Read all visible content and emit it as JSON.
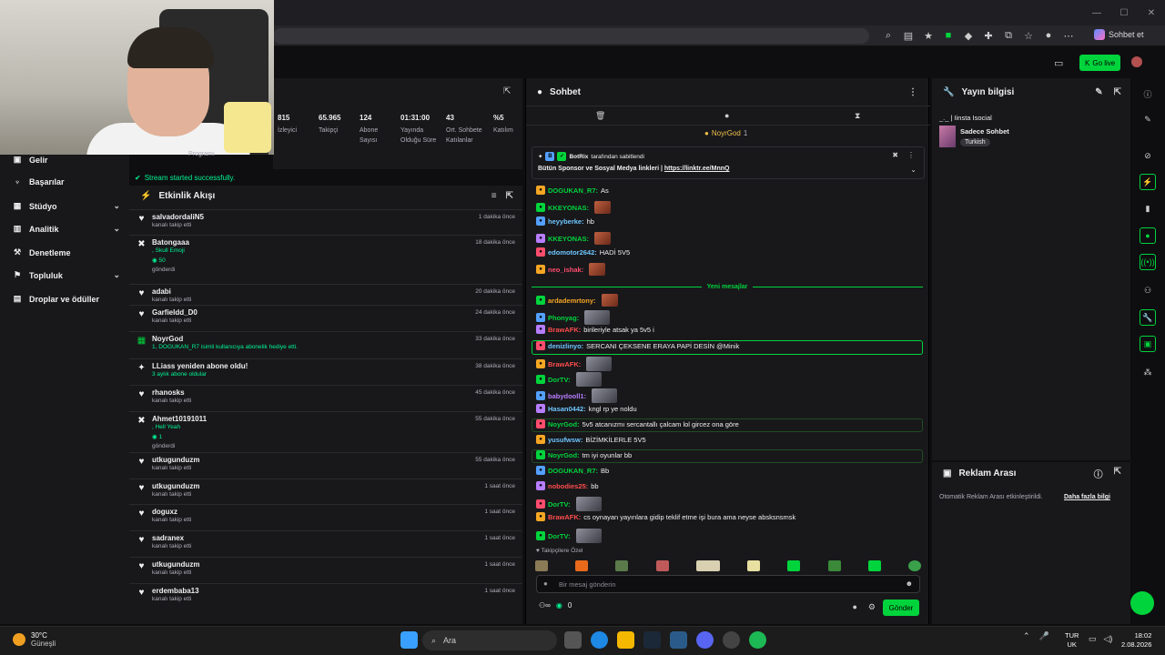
{
  "browser": {
    "profile_label": "Sohbet et"
  },
  "header": {
    "go_live_label": "Go live"
  },
  "sidebar": {
    "items": [
      {
        "label": "Gelir",
        "icon": "revenue-icon"
      },
      {
        "label": "Başarılar",
        "icon": "trophy-icon"
      },
      {
        "label": "Stüdyo",
        "icon": "studio-icon",
        "expand": true
      },
      {
        "label": "Analitik",
        "icon": "analytics-icon",
        "expand": true
      },
      {
        "label": "Denetleme",
        "icon": "moderation-icon"
      },
      {
        "label": "Topluluk",
        "icon": "community-icon",
        "expand": true
      },
      {
        "label": "Droplar ve ödüller",
        "icon": "drops-icon"
      }
    ]
  },
  "stats": [
    {
      "value": "815",
      "label": "İzleyici"
    },
    {
      "value": "65.965",
      "label": "Takipçi"
    },
    {
      "value": "124",
      "label": "Abone Sayısı"
    },
    {
      "value": "01:31:00",
      "label": "Yayında Olduğu Süre"
    },
    {
      "value": "43",
      "label": "Ort. Sohbete Katılanlar"
    },
    {
      "value": "%5",
      "label": "Katılım"
    }
  ],
  "stats_partial": "Programı",
  "stream_status": "Stream started successfully.",
  "activity": {
    "title": "Etkinlik Akışı",
    "items": [
      {
        "name": "salvadordaliN5",
        "sub": "kanalı takip etti",
        "time": "1 dakika önce",
        "type": "follow"
      },
      {
        "name": "Batongaaa",
        "sub": ", Skull Emoji",
        "sub2": "50",
        "sub3": "gönderdi",
        "time": "18 dakika önce",
        "type": "points"
      },
      {
        "name": "adabi",
        "sub": "kanalı takip etti",
        "time": "20 dakika önce",
        "type": "follow"
      },
      {
        "name": "Garfieldd_D0",
        "sub": "kanalı takip etti",
        "time": "24 dakika önce",
        "type": "follow"
      },
      {
        "name": "NoyrGod",
        "sub": "1, DOGUKAN_R7 isimli kullanıcıya abonelik hediye etti.",
        "time": "33 dakika önce",
        "type": "gift"
      },
      {
        "name": "LLiass yeniden abone oldu!",
        "sub": "3 aylık abone oldular",
        "time": "38 dakika önce",
        "type": "resub"
      },
      {
        "name": "rhanosks",
        "sub": "kanalı takip etti",
        "time": "45 dakika önce",
        "type": "follow"
      },
      {
        "name": "Ahmet10191011",
        "sub": ", Hell Yeah",
        "sub2": "1",
        "sub3": "gönderdi",
        "time": "55 dakika önce",
        "type": "points"
      },
      {
        "name": "utkugunduzm",
        "sub": "kanalı takip etti",
        "time": "55 dakika önce",
        "type": "follow"
      },
      {
        "name": "utkugunduzm",
        "sub": "kanalı takip etti",
        "time": "1 saat önce",
        "type": "follow"
      },
      {
        "name": "doguxz",
        "sub": "kanalı takip etti",
        "time": "1 saat önce",
        "type": "follow"
      },
      {
        "name": "sadranex",
        "sub": "kanalı takip etti",
        "time": "1 saat önce",
        "type": "follow"
      },
      {
        "name": "utkugunduzm",
        "sub": "kanalı takip etti",
        "time": "1 saat önce",
        "type": "follow"
      },
      {
        "name": "erdembaba13",
        "sub": "kanalı takip etti",
        "time": "1 saat önce",
        "type": "follow"
      }
    ]
  },
  "chat": {
    "title": "Sohbet",
    "top_gift_user": "NoyrGod",
    "top_gift_count": "1",
    "pinned_by": "BotRix",
    "pinned_by_suffix": "tarafından sabitlendi",
    "pinned_text": "Bütün Sponsor ve Sosyal Medya linkleri |",
    "pinned_link": "https://linktr.ee/MnnQ",
    "new_messages": "Yeni mesajlar",
    "messages": [
      {
        "user": "DOGUKAN_R7",
        "text": "As",
        "color": "#00d43c"
      },
      {
        "user": "KKEYONAS",
        "text": "",
        "color": "#00d43c",
        "emote": true
      },
      {
        "user": "heyyberke",
        "text": "hb",
        "color": "#6ec6ff"
      },
      {
        "user": "KKEYONAS",
        "text": "",
        "color": "#00d43c",
        "emote": true
      },
      {
        "user": "edomotor2642",
        "text": "HADİ 5V5",
        "color": "#6ec6ff"
      },
      {
        "user": "neo_ishak",
        "text": "",
        "color": "#ff4d6d",
        "emote": true
      },
      {
        "user": "ardademrtony",
        "text": "",
        "color": "#f5a623",
        "emote": true
      },
      {
        "user": "Phonyag",
        "text": "",
        "color": "#00d43c"
      },
      {
        "user": "BrawAFK",
        "text": "birileriyle atsak ya 5v5 i",
        "color": "#ff4d4d"
      },
      {
        "user": "denizlinyo",
        "text": "SERCANI ÇEKSENE ERAYA PAPİ DESİN @Minik",
        "color": "#6ec6ff"
      },
      {
        "user": "BrawAFK",
        "text": "",
        "color": "#ff4d4d"
      },
      {
        "user": "DorTV",
        "text": "",
        "color": "#00d43c"
      },
      {
        "user": "babydooll1",
        "text": "",
        "color": "#b77dff"
      },
      {
        "user": "Hasan0442",
        "text": "kngl rp ye noldu",
        "color": "#6ec6ff"
      },
      {
        "user": "NoyrGod",
        "text": "5v5 atcanızmı sercantallı çalcam lol gircez ona göre",
        "color": "#00d43c"
      },
      {
        "user": "yusufwsw",
        "text": "BİZİMKİLERLE 5V5",
        "color": "#6ec6ff"
      },
      {
        "user": "NoyrGod",
        "text": "tm iyi oyunlar bb",
        "color": "#00d43c"
      },
      {
        "user": "DOGUKAN_R7",
        "text": "Bb",
        "color": "#00d43c"
      },
      {
        "user": "nobodies25",
        "text": "bb",
        "color": "#ff4d4d"
      },
      {
        "user": "DorTV",
        "text": "",
        "color": "#00d43c"
      },
      {
        "user": "BrawAFK",
        "text": "cs oynayan yayınlara gidip teklif etme işi bura ama neyse absksnsmsk",
        "color": "#ff4d4d"
      },
      {
        "user": "DorTV",
        "text": "",
        "color": "#00d43c"
      }
    ],
    "followers_label": "Takipçilere Özel",
    "input_placeholder": "Bir mesaj gönderin",
    "points": "0",
    "send_label": "Gönder"
  },
  "stream_info": {
    "title": "Yayın bilgisi",
    "stream_title": "_._ | Iinsta Isocial",
    "category": "Sadece Sohbet",
    "tag": "Turkish"
  },
  "ads": {
    "title": "Reklam Arası",
    "text": "Otomatik Reklam Arası etkinleştirildi.",
    "link": "Daha fazla bilgi"
  },
  "taskbar": {
    "temp": "30°C",
    "weather": "Güneşli",
    "search": "Ara",
    "lang1": "TUR",
    "lang2": "UK",
    "time": "18:02",
    "date": "2.08.2026"
  }
}
